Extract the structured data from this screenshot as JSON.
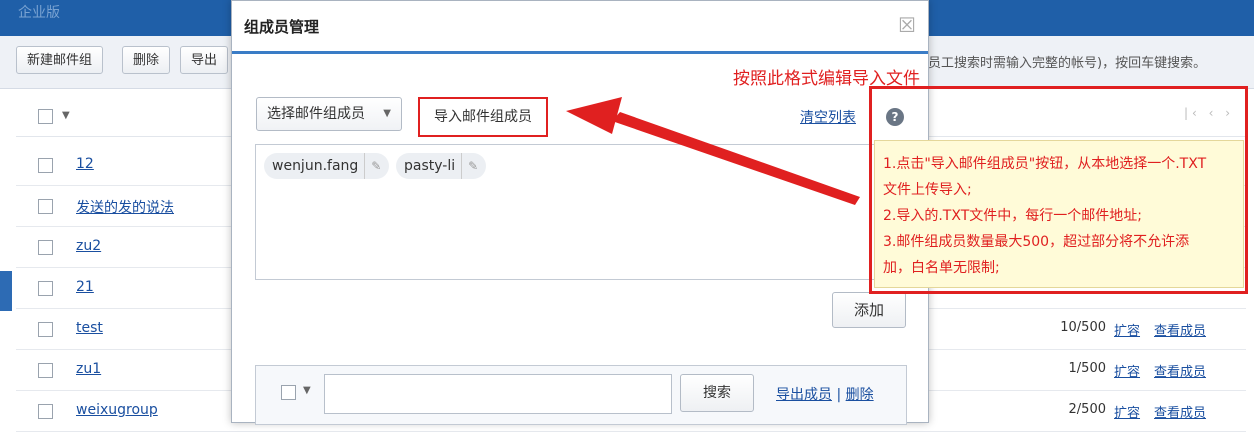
{
  "app": {
    "title": "企业版"
  },
  "toolbar": {
    "new_group": "新建邮件组",
    "delete": "删除",
    "export": "导出",
    "hint": "员工搜索时需输入完整的帐号)，按回车键搜索。"
  },
  "list": {
    "pager": "|‹ ‹ ›",
    "rows": [
      {
        "name": "12",
        "count": "",
        "expand": "",
        "view": ""
      },
      {
        "name": "发送的发的说法",
        "count": "",
        "expand": "",
        "view": ""
      },
      {
        "name": "zu2",
        "count": "",
        "expand": "",
        "view": ""
      },
      {
        "name": "21",
        "count": "",
        "expand": "",
        "view": ""
      },
      {
        "name": "test",
        "count": "10/500",
        "expand": "扩容",
        "view": "查看成员"
      },
      {
        "name": "zu1",
        "count": "1/500",
        "expand": "扩容",
        "view": "查看成员"
      },
      {
        "name": "weixugroup",
        "count": "2/500",
        "expand": "扩容",
        "view": "查看成员"
      }
    ]
  },
  "modal": {
    "title": "组成员管理",
    "close_glyph": "☒",
    "select_members": "选择邮件组成员",
    "import_members": "导入邮件组成员",
    "clear_list": "清空列表",
    "tags": [
      "wenjun.fang",
      "pasty-li"
    ],
    "add": "添加",
    "search": "搜索",
    "export_members": "导出成员",
    "separator": "|",
    "delete": "删除"
  },
  "annotation": {
    "note": "按照此格式编辑导入文件",
    "tip_lines": [
      "1.点击\"导入邮件组成员\"按钮，从本地选择一个.TXT",
      "文件上传导入;",
      "2.导入的.TXT文件中，每行一个邮件地址;",
      "3.邮件组成员数量最大500，超过部分将不允许添",
      "加，白名单无限制;"
    ],
    "color": "#e02020"
  }
}
